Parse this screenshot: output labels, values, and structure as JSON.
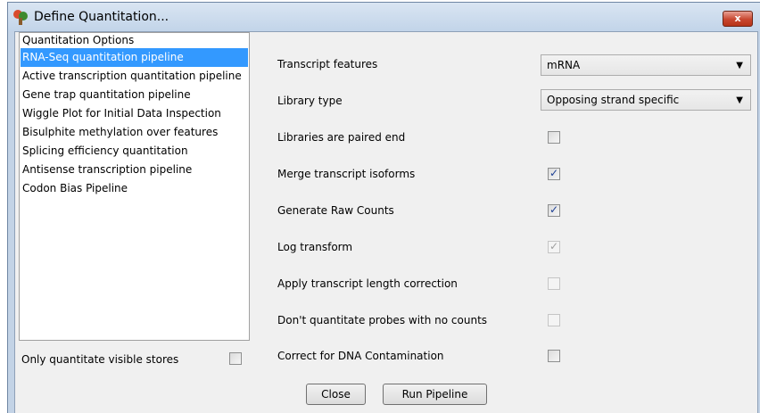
{
  "window": {
    "title": "Define Quantitation...",
    "close_glyph": "x"
  },
  "options_list": {
    "heading": "Quantitation Options",
    "items": [
      {
        "label": "RNA-Seq quantitation pipeline",
        "selected": true
      },
      {
        "label": "Active transcription quantitation pipeline"
      },
      {
        "label": "Gene trap quantitation pipeline"
      },
      {
        "label": "Wiggle Plot for Initial Data Inspection"
      },
      {
        "label": "Bisulphite methylation over features"
      },
      {
        "label": "Splicing efficiency quantitation"
      },
      {
        "label": "Antisense transcription pipeline"
      },
      {
        "label": "Codon Bias Pipeline"
      }
    ]
  },
  "visible_stores": {
    "label": "Only quantitate visible stores",
    "checked": false
  },
  "settings": {
    "transcript_features": {
      "label": "Transcript features",
      "value": "mRNA"
    },
    "library_type": {
      "label": "Library type",
      "value": "Opposing strand specific"
    },
    "paired_end": {
      "label": "Libraries are paired end",
      "checked": false,
      "enabled": true
    },
    "merge_isoforms": {
      "label": "Merge transcript isoforms",
      "checked": true,
      "enabled": true
    },
    "raw_counts": {
      "label": "Generate Raw Counts",
      "checked": true,
      "enabled": true
    },
    "log_transform": {
      "label": "Log transform",
      "checked": true,
      "enabled": false
    },
    "length_correction": {
      "label": "Apply transcript length correction",
      "checked": false,
      "enabled": false
    },
    "no_count_probes": {
      "label": "Don't quantitate probes with no counts",
      "checked": false,
      "enabled": false
    },
    "dna_contamination": {
      "label": "Correct for DNA Contamination",
      "checked": false,
      "enabled": true
    }
  },
  "buttons": {
    "close": "Close",
    "run": "Run Pipeline"
  },
  "colors": {
    "selection": "#3399ff",
    "titlebar": "#c2d4e9",
    "close_button": "#c8462f"
  }
}
